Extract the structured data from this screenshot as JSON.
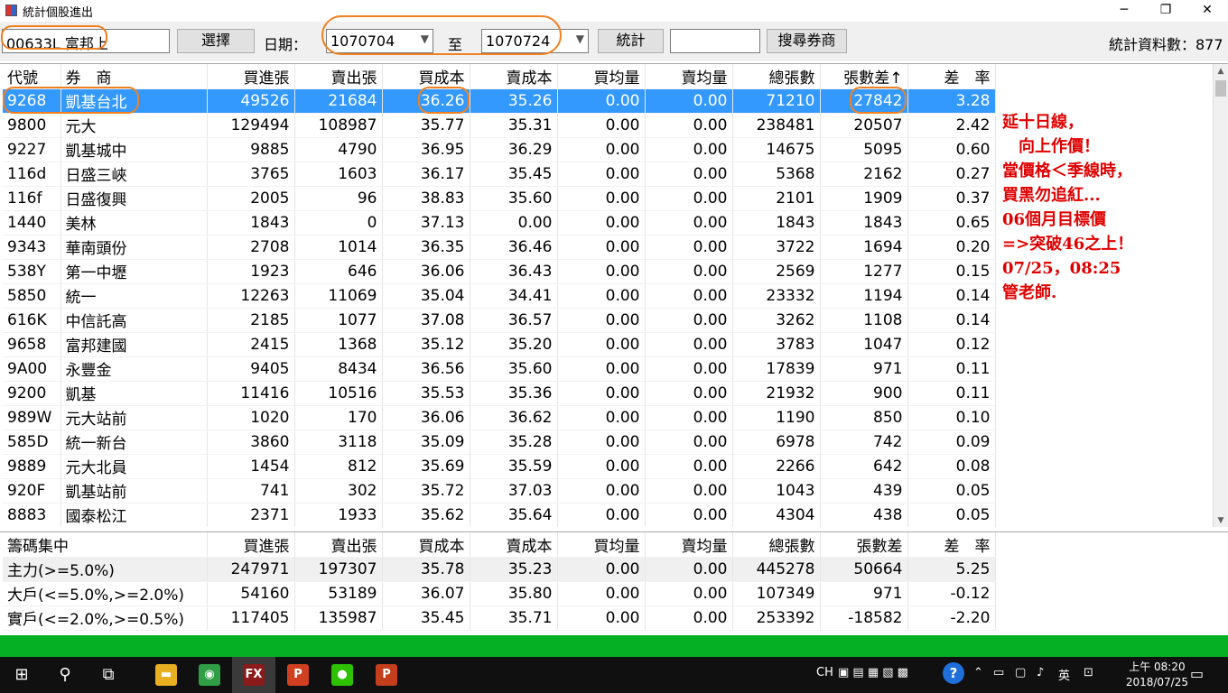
{
  "window": {
    "title": "統計個股進出",
    "minimize": "─",
    "maximize": "❐",
    "close": "✕"
  },
  "toolbar": {
    "stock_value": "00633L 富邦上",
    "select_label": "選擇",
    "date_label": "日期：",
    "date_from": "1070704",
    "to_label": "至",
    "date_to": "1070724",
    "stat_label": "統計",
    "search_value": "",
    "search_broker_label": "搜尋券商",
    "record_count_label": "統計資料數：877"
  },
  "grid": {
    "headers": [
      "代號",
      "券　商",
      "買進張",
      "賣出張",
      "買成本",
      "賣成本",
      "買均量",
      "賣均量",
      "總張數",
      "張數差↑",
      "差　率"
    ],
    "rows": [
      [
        "9268",
        "凱基台北",
        "49526",
        "21684",
        "36.26",
        "35.26",
        "0.00",
        "0.00",
        "71210",
        "27842",
        "3.28"
      ],
      [
        "9800",
        "元大",
        "129494",
        "108987",
        "35.77",
        "35.31",
        "0.00",
        "0.00",
        "238481",
        "20507",
        "2.42"
      ],
      [
        "9227",
        "凱基城中",
        "9885",
        "4790",
        "36.95",
        "36.29",
        "0.00",
        "0.00",
        "14675",
        "5095",
        "0.60"
      ],
      [
        "116d",
        "日盛三峽",
        "3765",
        "1603",
        "36.17",
        "35.45",
        "0.00",
        "0.00",
        "5368",
        "2162",
        "0.27"
      ],
      [
        "116f",
        "日盛復興",
        "2005",
        "96",
        "38.83",
        "35.60",
        "0.00",
        "0.00",
        "2101",
        "1909",
        "0.37"
      ],
      [
        "1440",
        "美林",
        "1843",
        "0",
        "37.13",
        "0.00",
        "0.00",
        "0.00",
        "1843",
        "1843",
        "0.65"
      ],
      [
        "9343",
        "華南頭份",
        "2708",
        "1014",
        "36.35",
        "36.46",
        "0.00",
        "0.00",
        "3722",
        "1694",
        "0.20"
      ],
      [
        "538Y",
        "第一中壢",
        "1923",
        "646",
        "36.06",
        "36.43",
        "0.00",
        "0.00",
        "2569",
        "1277",
        "0.15"
      ],
      [
        "5850",
        "統一",
        "12263",
        "11069",
        "35.04",
        "34.41",
        "0.00",
        "0.00",
        "23332",
        "1194",
        "0.14"
      ],
      [
        "616K",
        "中信託高",
        "2185",
        "1077",
        "37.08",
        "36.57",
        "0.00",
        "0.00",
        "3262",
        "1108",
        "0.14"
      ],
      [
        "9658",
        "富邦建國",
        "2415",
        "1368",
        "35.12",
        "35.20",
        "0.00",
        "0.00",
        "3783",
        "1047",
        "0.12"
      ],
      [
        "9A00",
        "永豐金",
        "9405",
        "8434",
        "36.56",
        "35.60",
        "0.00",
        "0.00",
        "17839",
        "971",
        "0.11"
      ],
      [
        "9200",
        "凱基",
        "11416",
        "10516",
        "35.53",
        "35.36",
        "0.00",
        "0.00",
        "21932",
        "900",
        "0.11"
      ],
      [
        "989W",
        "元大站前",
        "1020",
        "170",
        "36.06",
        "36.62",
        "0.00",
        "0.00",
        "1190",
        "850",
        "0.10"
      ],
      [
        "585D",
        "統一新台",
        "3860",
        "3118",
        "35.09",
        "35.28",
        "0.00",
        "0.00",
        "6978",
        "742",
        "0.09"
      ],
      [
        "9889",
        "元大北員",
        "1454",
        "812",
        "35.69",
        "35.59",
        "0.00",
        "0.00",
        "2266",
        "642",
        "0.08"
      ],
      [
        "920F",
        "凱基站前",
        "741",
        "302",
        "35.72",
        "37.03",
        "0.00",
        "0.00",
        "1043",
        "439",
        "0.05"
      ],
      [
        "8883",
        "國泰松江",
        "2371",
        "1933",
        "35.62",
        "35.64",
        "0.00",
        "0.00",
        "4304",
        "438",
        "0.05"
      ]
    ]
  },
  "note_lines": [
    "延十日線，",
    "　向上作價！",
    "當價格＜季線時，",
    "買黑勿追紅...",
    "06個月目標價",
    "=>突破46之上！",
    "07/25，08:25",
    "管老師."
  ],
  "summary": {
    "headers": [
      "籌碼集中",
      "買進張",
      "賣出張",
      "買成本",
      "賣成本",
      "買均量",
      "賣均量",
      "總張數",
      "張數差",
      "差　率"
    ],
    "rows": [
      [
        "主力(>=5.0%)",
        "247971",
        "197307",
        "35.78",
        "35.23",
        "0.00",
        "0.00",
        "445278",
        "50664",
        "5.25"
      ],
      [
        "大戶(<=5.0%,>=2.0%)",
        "54160",
        "53189",
        "36.07",
        "35.80",
        "0.00",
        "0.00",
        "107349",
        "971",
        "-0.12"
      ],
      [
        "實戶(<=2.0%,>=0.5%)",
        "117405",
        "135987",
        "35.45",
        "35.71",
        "0.00",
        "0.00",
        "253392",
        "-18582",
        "-2.20"
      ]
    ]
  },
  "taskbar": {
    "start_icon": "⊞",
    "search_icon": "⚲",
    "taskview_icon": "⧉",
    "apps": [
      {
        "name": "file-explorer-icon",
        "text": "▬",
        "color": "#e8b020"
      },
      {
        "name": "chrome-icon",
        "text": "◉",
        "color": "#2f9e44"
      },
      {
        "name": "fx-app-icon",
        "text": "FX",
        "color": "#8b1a1a"
      },
      {
        "name": "p-app-icon",
        "text": "P",
        "color": "#d04020"
      },
      {
        "name": "wechat-icon",
        "text": "●",
        "color": "#2dc100"
      },
      {
        "name": "powerpoint-icon",
        "text": "P",
        "color": "#c43e1c"
      }
    ],
    "tray_text": "CH",
    "ime_text": "英",
    "clock_time": "上午 08:20",
    "clock_date": "2018/07/25"
  }
}
